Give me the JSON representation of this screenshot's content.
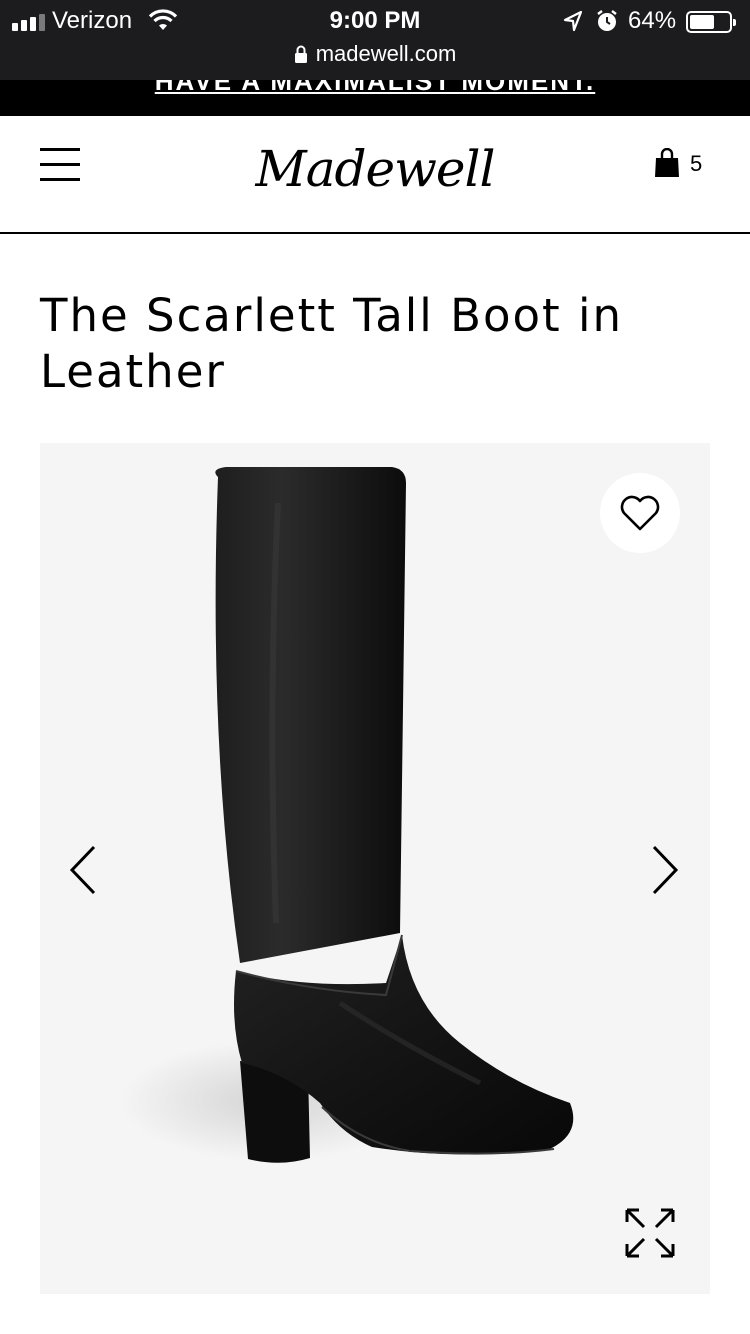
{
  "status_bar": {
    "carrier": "Verizon",
    "time": "9:00 PM",
    "battery_percent": "64%",
    "battery_level": 0.64,
    "url": "madewell.com",
    "icons": [
      "signal-icon",
      "wifi-icon",
      "location-icon",
      "alarm-icon",
      "battery-icon",
      "lock-icon"
    ]
  },
  "promo_banner": {
    "text": "HAVE A MAXIMALIST MOMENT."
  },
  "header": {
    "logo": "Madewell",
    "bag_count": "5",
    "icons": [
      "menu-icon",
      "shopping-bag-icon"
    ]
  },
  "product": {
    "title": "The Scarlett Tall Boot in Leather"
  },
  "gallery": {
    "icons": [
      "heart-icon",
      "chevron-left-icon",
      "chevron-right-icon",
      "expand-icon"
    ]
  },
  "colors": {
    "status_bar_bg": "#1c1c1e",
    "banner_bg": "#000000",
    "image_bg": "#f5f5f5"
  }
}
